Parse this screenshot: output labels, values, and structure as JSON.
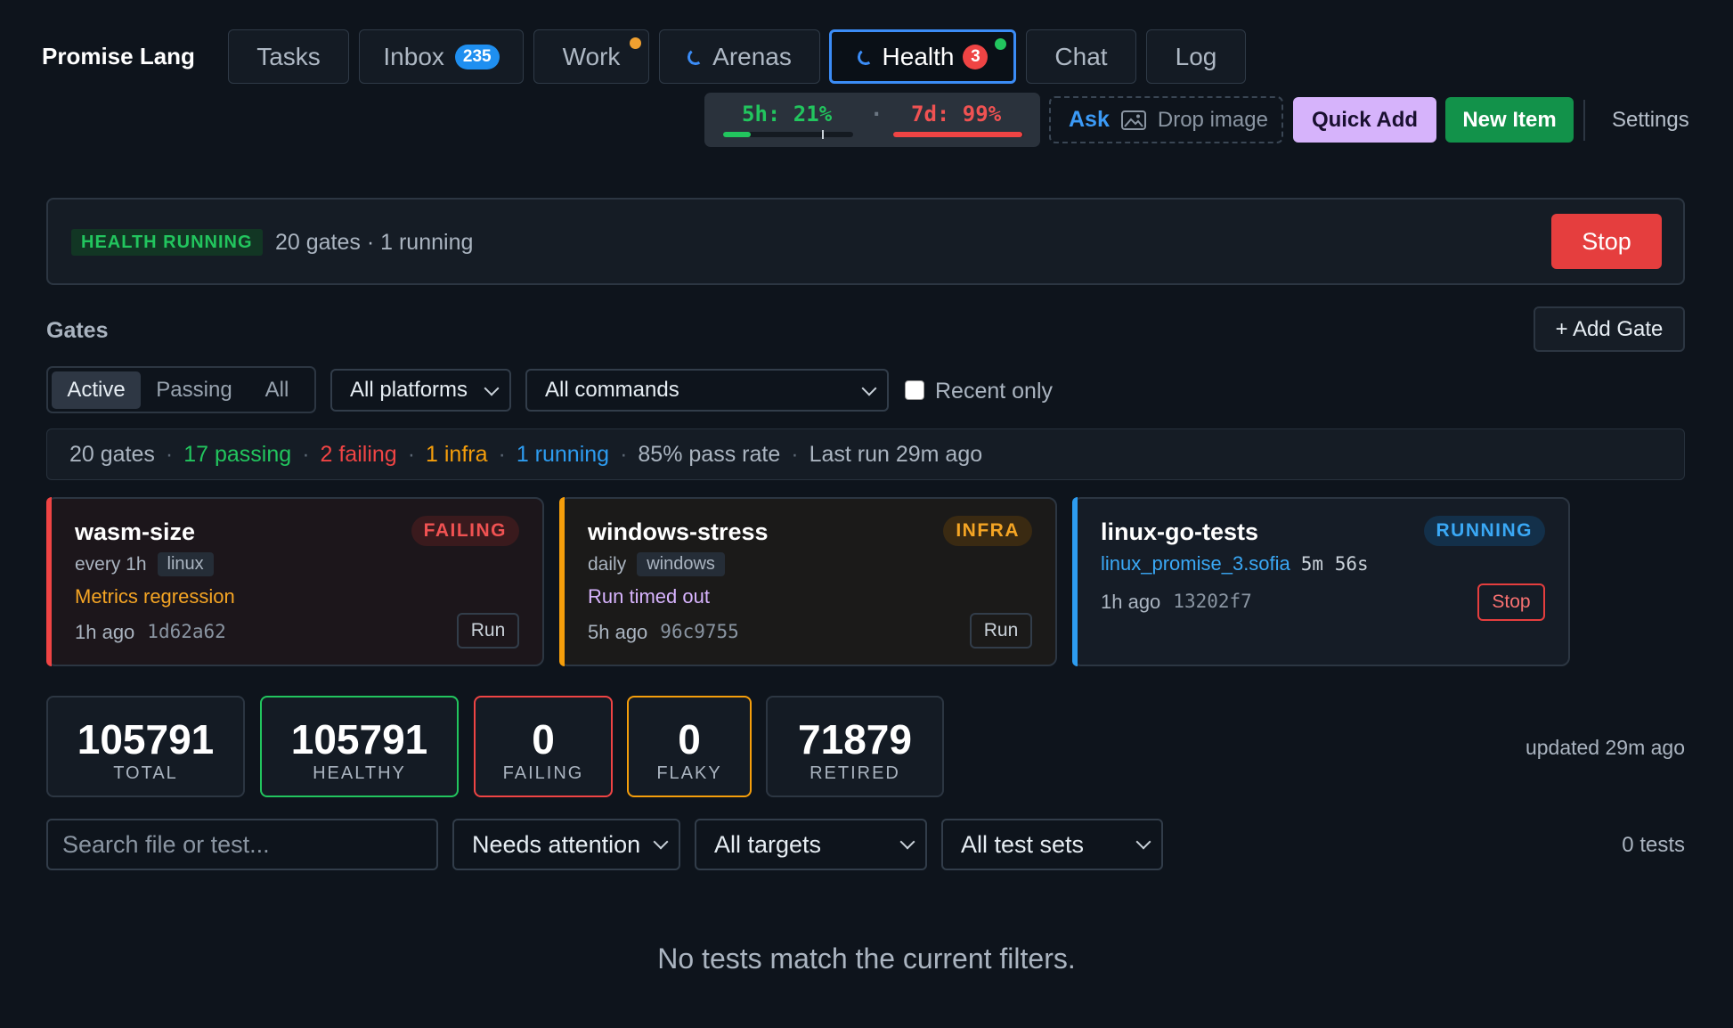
{
  "app": {
    "title": "Promise Lang"
  },
  "tabs": [
    {
      "label": "Tasks"
    },
    {
      "label": "Inbox",
      "badge": "235"
    },
    {
      "label": "Work"
    },
    {
      "label": "Arenas"
    },
    {
      "label": "Health",
      "badge": "3"
    },
    {
      "label": "Chat"
    },
    {
      "label": "Log"
    }
  ],
  "usage": {
    "five_hour": {
      "label": "5h: 21%",
      "progress": 0.21,
      "marker": 0.76
    },
    "separator": "·",
    "seven_day": {
      "label": "7d: 99%",
      "progress": 0.99
    }
  },
  "ask": {
    "label": "Ask",
    "drop_label": "Drop image"
  },
  "actions": {
    "quick_add": "Quick Add",
    "new_item": "New Item",
    "settings": "Settings"
  },
  "banner": {
    "status": "HEALTH RUNNING",
    "detail": "20 gates · 1 running",
    "stop": "Stop"
  },
  "gates": {
    "title": "Gates",
    "add_gate": "+ Add Gate",
    "filters": [
      "Active",
      "Passing",
      "All"
    ],
    "platform_select": "All platforms",
    "command_select": "All commands",
    "recent_only": "Recent only"
  },
  "summary": {
    "total": "20 gates",
    "passing": "17 passing",
    "failing": "2 failing",
    "infra": "1 infra",
    "running": "1 running",
    "pass_rate": "85% pass rate",
    "last_run": "Last run 29m ago",
    "sep": "·"
  },
  "cards": [
    {
      "name": "wasm-size",
      "status": "FAILING",
      "schedule": "every 1h",
      "platform": "linux",
      "message": "Metrics regression",
      "age": "1h ago",
      "commit": "1d62a62",
      "action": "Run"
    },
    {
      "name": "windows-stress",
      "status": "INFRA",
      "schedule": "daily",
      "platform": "windows",
      "message": "Run timed out",
      "age": "5h ago",
      "commit": "96c9755",
      "action": "Run"
    },
    {
      "name": "linux-go-tests",
      "status": "RUNNING",
      "runner": "linux_promise_3.sofia",
      "elapsed": "5m 56s",
      "age": "1h ago",
      "commit": "13202f7",
      "action": "Stop"
    }
  ],
  "stats": [
    {
      "value": "105791",
      "label": "TOTAL"
    },
    {
      "value": "105791",
      "label": "HEALTHY"
    },
    {
      "value": "0",
      "label": "FAILING"
    },
    {
      "value": "0",
      "label": "FLAKY"
    },
    {
      "value": "71879",
      "label": "RETIRED"
    }
  ],
  "updated": "updated 29m ago",
  "tests": {
    "search_placeholder": "Search file or test...",
    "attention_select": "Needs attention",
    "targets_select": "All targets",
    "sets_select": "All test sets",
    "count": "0 tests",
    "empty": "No tests match the current filters."
  },
  "colors": {
    "accent": "#3b8cf6",
    "green": "#22c55e",
    "red": "#ef4444",
    "orange": "#f59e0b",
    "blue": "#2d9cf0",
    "purple": "#d8b4fe"
  }
}
